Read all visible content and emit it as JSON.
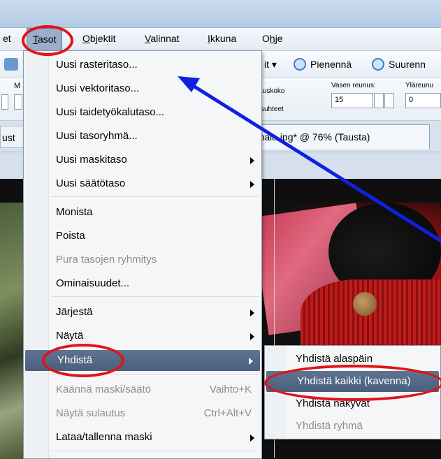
{
  "menubar": {
    "items": [
      {
        "label": "et",
        "underline": ""
      },
      {
        "label": "Tasot",
        "underline": "T"
      },
      {
        "label": "Objektit",
        "underline": "O"
      },
      {
        "label": "Valinnat",
        "underline": "V"
      },
      {
        "label": "Ikkuna",
        "underline": "I"
      },
      {
        "label": "Ohje",
        "underline": "h"
      }
    ]
  },
  "toolbar": {
    "fit_label": "it",
    "zoom_out_label": "Pienennä",
    "zoom_in_label": "Suurenn",
    "left_letter": "M",
    "size_label": "tuskoko",
    "ratio_label": "suhteet",
    "left_margin_label": "Vasen reunus:",
    "top_margin_label": "Yläreunu",
    "left_margin_value": "15",
    "top_margin_value": "0"
  },
  "tabs": {
    "left_tab": "ust",
    "document_tab": "mupala.jpg* @ 76% (Tausta)"
  },
  "menu": {
    "new_raster": "Uusi rasteritaso...",
    "new_vector": "Uusi vektoritaso...",
    "new_art": "Uusi taidetyökalutaso...",
    "new_group": "Uusi tasoryhmä...",
    "new_mask": "Uusi maskitaso",
    "new_adjust": "Uusi säätötaso",
    "duplicate": "Monista",
    "delete": "Poista",
    "ungroup": "Pura tasojen ryhmitys",
    "properties": "Ominaisuudet...",
    "arrange": "Järjestä",
    "view": "Näytä",
    "merge": "Yhdistä",
    "invert_mask": "Käännä maski/säätö",
    "invert_mask_shortcut": "Vaihto+K",
    "show_blend": "Näytä sulautus",
    "show_blend_shortcut": "Ctrl+Alt+V",
    "load_save_mask": "Lataa/tallenna maski"
  },
  "submenu": {
    "merge_down": "Yhdistä alaspäin",
    "merge_all": "Yhdistä kaikki (kavenna)",
    "merge_visible": "Yhdistä näkyvät",
    "merge_group": "Yhdistä ryhmä"
  },
  "colors": {
    "highlight": "#4f6583",
    "annotation_red": "#e0141a",
    "annotation_blue": "#1020e0"
  }
}
